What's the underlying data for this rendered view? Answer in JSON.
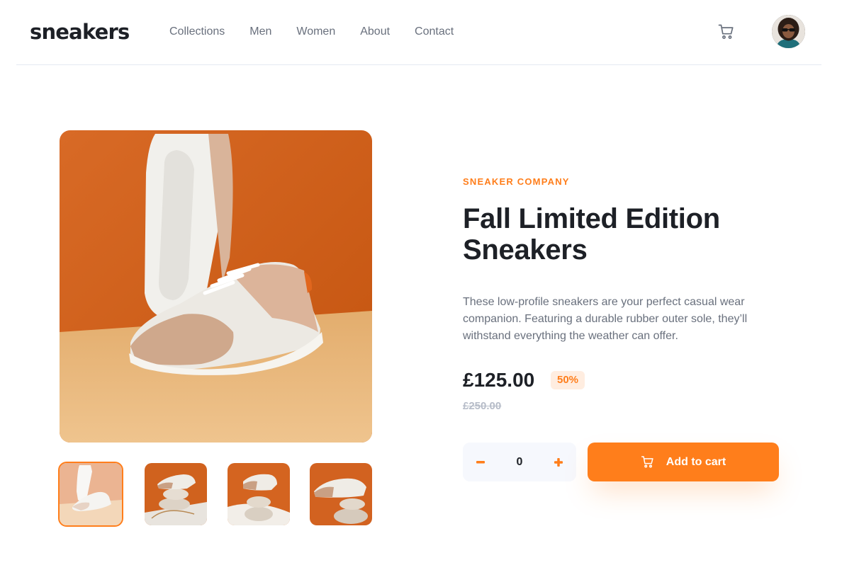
{
  "header": {
    "logo": "sneakers",
    "nav": [
      "Collections",
      "Men",
      "Women",
      "About",
      "Contact"
    ],
    "cart_icon": "cart-icon",
    "avatar_icon": "avatar"
  },
  "gallery": {
    "thumbnails": [
      "thumb-1",
      "thumb-2",
      "thumb-3",
      "thumb-4"
    ],
    "active_thumbnail": 0
  },
  "product": {
    "company": "SNEAKER COMPANY",
    "title": "Fall Limited Edition Sneakers",
    "description": "These low-profile sneakers are your perfect casual wear companion. Featuring a durable rubber outer sole, they’ll withstand everything the weather can offer.",
    "price": "£125.00",
    "discount": "50%",
    "old_price": "£250.00"
  },
  "cart_controls": {
    "quantity": "0",
    "minus_icon": "minus-icon",
    "plus_icon": "plus-icon",
    "add_label": "Add to cart"
  },
  "colors": {
    "accent": "#ff7e1b",
    "accent_pale": "#ffede0",
    "text_dark": "#1d2026",
    "text_muted": "#69707d",
    "text_light": "#b6bcc8"
  }
}
